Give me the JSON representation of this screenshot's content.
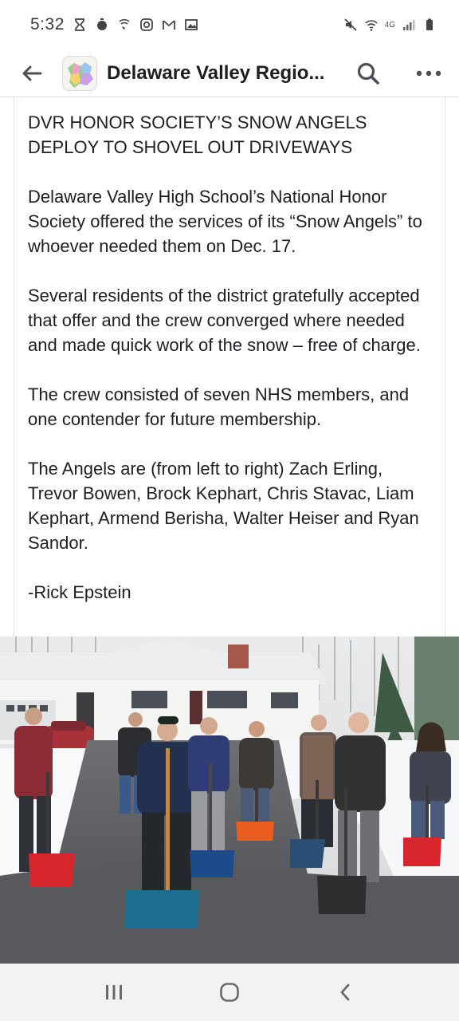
{
  "status_bar": {
    "time": "5:32",
    "network": "4G"
  },
  "header": {
    "page_name": "Delaware Valley Regio...",
    "icons": [
      "back-arrow-icon",
      "search-icon",
      "more-options-icon"
    ]
  },
  "post": {
    "headline": "DVR HONOR SOCIETY’S SNOW ANGELS DEPLOY TO SHOVEL OUT DRIVEWAYS",
    "paragraph_1": "Delaware Valley High School’s National Honor Society offered the services of its “Snow Angels” to whoever needed them on Dec. 17.",
    "paragraph_2": "Several residents of the district gratefully accepted that offer and the crew converged where needed and made quick work of the snow – free of charge.",
    "paragraph_3": "The crew consisted of seven NHS members, and one contender for future membership.",
    "paragraph_4": "The Angels are (from left to right) Zach Erling, Trevor Bowen, Brock Kephart, Chris Stavac, Liam Kephart, Armend Berisha, Walter Heiser and Ryan Sandor.",
    "signature": "-Rick Epstein"
  },
  "nav_bar": {
    "icons": [
      "recent-apps-icon",
      "home-icon",
      "back-icon"
    ]
  },
  "colors": {
    "header_text": "#1c1e21",
    "nav_bg": "#f2f2f2",
    "icon_gray": "#4b4f56"
  }
}
